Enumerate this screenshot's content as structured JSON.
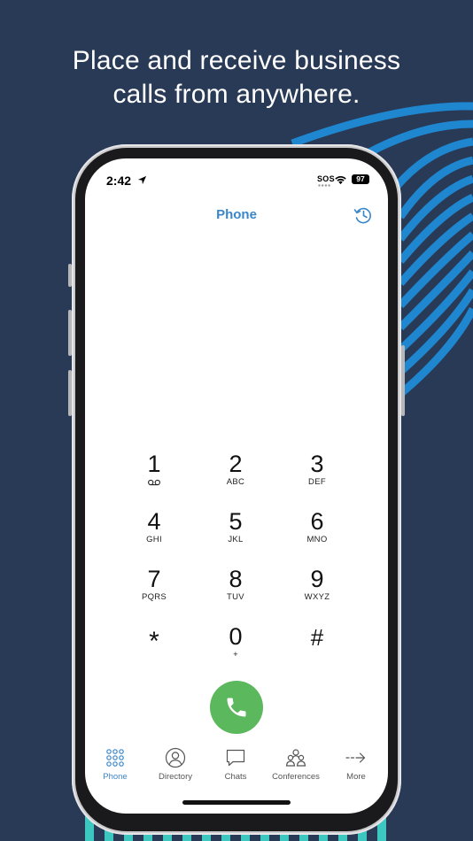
{
  "headline": {
    "line1": "Place and receive business",
    "line2": "calls from anywhere."
  },
  "status_bar": {
    "time": "2:42",
    "carrier": "SOS",
    "battery": "97"
  },
  "nav": {
    "title": "Phone",
    "history_icon": "history-clock-icon"
  },
  "keypad": [
    {
      "digit": "1",
      "letters": "",
      "icon": "voicemail-icon"
    },
    {
      "digit": "2",
      "letters": "ABC"
    },
    {
      "digit": "3",
      "letters": "DEF"
    },
    {
      "digit": "4",
      "letters": "GHI"
    },
    {
      "digit": "5",
      "letters": "JKL"
    },
    {
      "digit": "6",
      "letters": "MNO"
    },
    {
      "digit": "7",
      "letters": "PQRS"
    },
    {
      "digit": "8",
      "letters": "TUV"
    },
    {
      "digit": "9",
      "letters": "WXYZ"
    },
    {
      "digit": "*",
      "letters": ""
    },
    {
      "digit": "0",
      "letters": "+"
    },
    {
      "digit": "#",
      "letters": ""
    }
  ],
  "call_button": {
    "icon": "phone-icon",
    "color": "#5cb85c"
  },
  "tabs": [
    {
      "label": "Phone",
      "icon": "keypad-icon",
      "active": true
    },
    {
      "label": "Directory",
      "icon": "person-icon"
    },
    {
      "label": "Chats",
      "icon": "chat-bubble-icon"
    },
    {
      "label": "Conferences",
      "icon": "group-icon"
    },
    {
      "label": "More",
      "icon": "arrow-right-icon"
    }
  ],
  "colors": {
    "background": "#283a56",
    "accent": "#3a86c8",
    "arc_blue": "#1f86d0",
    "teal": "#3cc8c0",
    "call_green": "#5cb85c"
  }
}
